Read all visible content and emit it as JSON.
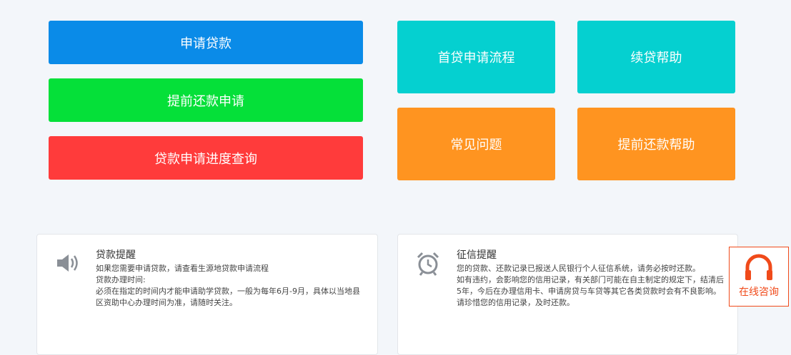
{
  "buttons": {
    "apply": {
      "label": "申请贷款",
      "color": "#0a8be8"
    },
    "prepay_apply": {
      "label": "提前还款申请",
      "color": "#05e039"
    },
    "progress_query": {
      "label": "贷款申请进度查询",
      "color": "#ff3b3b"
    },
    "first_loan_process": {
      "label": "首贷申请流程",
      "color": "#05d0d0"
    },
    "renew_help": {
      "label": "续贷帮助",
      "color": "#05d0d0"
    },
    "faq": {
      "label": "常见问题",
      "color": "#ff9420"
    },
    "prepay_help": {
      "label": "提前还款帮助",
      "color": "#ff9420"
    }
  },
  "cards": {
    "loan_reminder": {
      "icon": "speaker-icon",
      "title": "贷款提醒",
      "body": "如果您需要申请贷款，请查看生源地贷款申请流程\n贷款办理时间:\n必须在指定的时间内才能申请助学贷款，一般为每年6月-9月，具体以当地县区资助中心办理时间为准，请随时关注。"
    },
    "credit_reminder": {
      "icon": "alarm-clock-icon",
      "title": "征信提醒",
      "body": "您的贷款、还款记录已报送人民银行个人征信系统，请务必按时还款。\n如有违约，会影响您的信用记录，有关部门可能在自主制定的规定下，结清后5年，今后在办理信用卡、申请房贷与车贷等其它各类贷款时会有不良影响。\n请珍惜您的信用记录，及时还款。"
    }
  },
  "consult": {
    "label": "在线咨询",
    "icon": "headphones-icon",
    "color": "#f04a1a"
  }
}
